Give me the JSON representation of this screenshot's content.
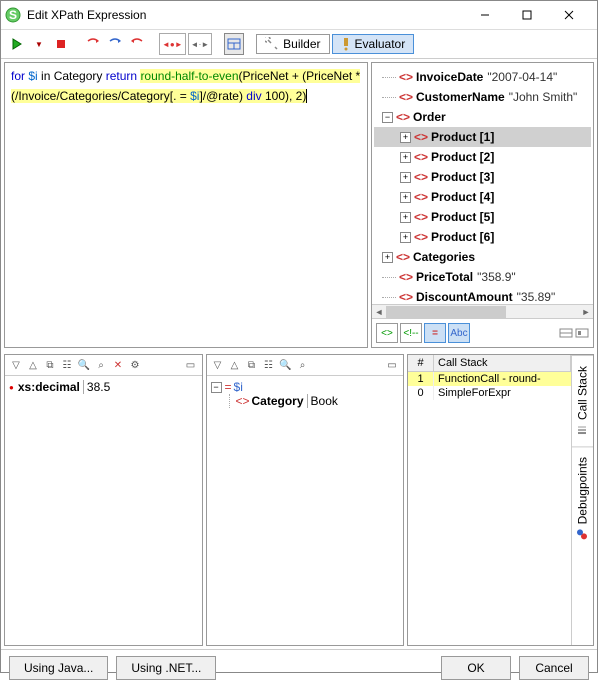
{
  "title": "Edit XPath Expression",
  "toolbar": {
    "builder": "Builder",
    "evaluator": "Evaluator"
  },
  "expr": {
    "p1a": "for ",
    "p1b": "$i",
    "p1c": " in Category ",
    "p1d": "return",
    "p1e": " ",
    "fn": "round-half-to-even",
    "p2a": "(PriceNet + (PriceNet *(/Invoice/Categories/Category[. = ",
    "p2b": "$i",
    "p2c": "]/@rate) ",
    "p2d": "div",
    "p2e": " 100), 2)"
  },
  "tree": [
    {
      "lvl": 1,
      "exp": "",
      "name": "InvoiceDate",
      "val": "\"2007-04-14\""
    },
    {
      "lvl": 1,
      "exp": "",
      "name": "CustomerName",
      "val": "\"John Smith\""
    },
    {
      "lvl": 1,
      "exp": "-",
      "name": "Order",
      "val": ""
    },
    {
      "lvl": 2,
      "exp": "+",
      "name": "Product [1]",
      "val": "",
      "sel": true
    },
    {
      "lvl": 2,
      "exp": "+",
      "name": "Product [2]",
      "val": ""
    },
    {
      "lvl": 2,
      "exp": "+",
      "name": "Product [3]",
      "val": ""
    },
    {
      "lvl": 2,
      "exp": "+",
      "name": "Product [4]",
      "val": ""
    },
    {
      "lvl": 2,
      "exp": "+",
      "name": "Product [5]",
      "val": ""
    },
    {
      "lvl": 2,
      "exp": "+",
      "name": "Product [6]",
      "val": ""
    },
    {
      "lvl": 1,
      "exp": "+",
      "name": "Categories",
      "val": ""
    },
    {
      "lvl": 1,
      "exp": "",
      "name": "PriceTotal",
      "val": "\"358.9\""
    },
    {
      "lvl": 1,
      "exp": "",
      "name": "DiscountAmount",
      "val": "\"35.89\""
    }
  ],
  "tree_toolbar": {
    "abc": "Abc"
  },
  "result": {
    "type": "xs:decimal",
    "value": "38.5"
  },
  "watch": {
    "var": "$i",
    "child_name": "Category",
    "child_val": "Book"
  },
  "stack": {
    "hdr_n": "#",
    "hdr_s": "Call Stack",
    "rows": [
      {
        "n": "1",
        "s": "FunctionCall - round-",
        "sel": true
      },
      {
        "n": "0",
        "s": "SimpleForExpr"
      }
    ]
  },
  "side_tabs": {
    "t1": "Call Stack",
    "t2": "Debugpoints"
  },
  "footer": {
    "java": "Using Java...",
    "net": "Using .NET...",
    "ok": "OK",
    "cancel": "Cancel"
  }
}
